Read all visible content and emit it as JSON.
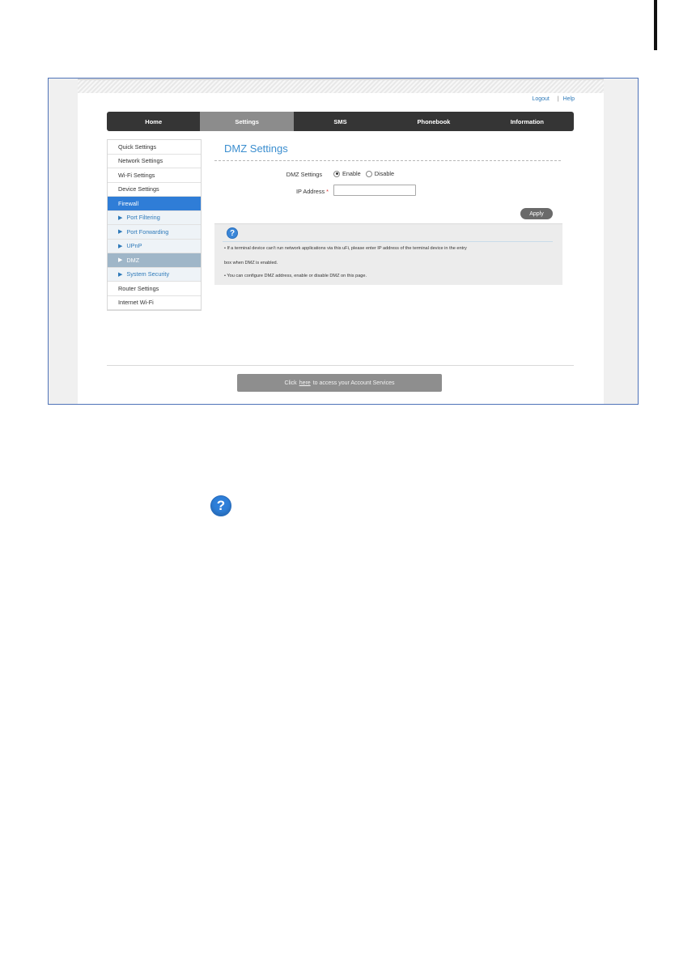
{
  "header": {
    "logout_label": "Logout",
    "separator": "|",
    "help_label": "Help"
  },
  "nav": {
    "tabs": [
      {
        "label": "Home"
      },
      {
        "label": "Settings"
      },
      {
        "label": "SMS"
      },
      {
        "label": "Phonebook"
      },
      {
        "label": "Information"
      }
    ],
    "active_tab": "Settings"
  },
  "sidebar": {
    "items": [
      {
        "label": "Quick Settings"
      },
      {
        "label": "Network Settings"
      },
      {
        "label": "Wi-Fi Settings"
      },
      {
        "label": "Device Settings"
      },
      {
        "label": "Firewall"
      },
      {
        "label": "Port Filtering"
      },
      {
        "label": "Port Forwarding"
      },
      {
        "label": "UPnP"
      },
      {
        "label": "DMZ"
      },
      {
        "label": "System Security"
      },
      {
        "label": "Router Settings"
      },
      {
        "label": "Internet Wi-Fi"
      }
    ],
    "selected_item": "DMZ"
  },
  "main": {
    "title": "DMZ Settings",
    "dmz_label": "DMZ Settings",
    "enable_label": "Enable",
    "disable_label": "Disable",
    "selected_option": "Enable",
    "ip_label": "IP Address",
    "required_mark": "*",
    "ip_value": "",
    "apply_label": "Apply"
  },
  "help": {
    "icon_glyph": "?",
    "line1": "• If a terminal device can't run network applications via this uFi, please enter IP address of the terminal device in the entry",
    "line2": "box when DMZ is enabled.",
    "line3": "• You can configure DMZ address, enable or disable DMZ on this page."
  },
  "footer": {
    "account_prefix": "Click",
    "account_link": "here",
    "account_suffix": "to access your Account Services"
  },
  "colors": {
    "accent": "#2f7dd7",
    "nav_bg": "#353535",
    "title": "#3b8ecf"
  }
}
